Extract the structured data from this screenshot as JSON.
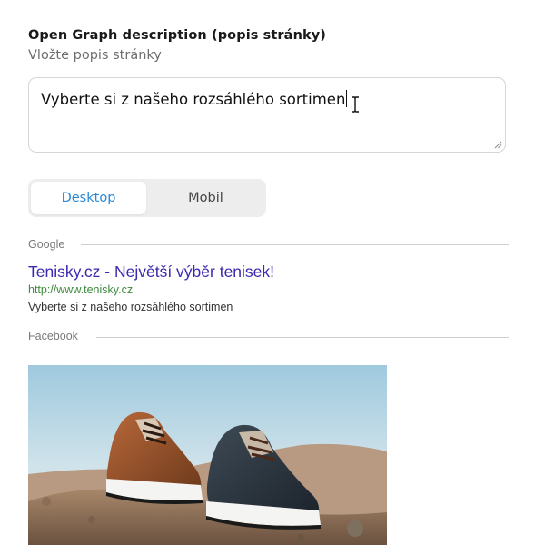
{
  "og_description": {
    "label": "Open Graph description (popis stránky)",
    "hint": "Vložte popis stránky",
    "value": "Vyberte si z našeho rozsáhlého sortimen"
  },
  "preview_toggle": {
    "options": [
      {
        "label": "Desktop",
        "active": true
      },
      {
        "label": "Mobil",
        "active": false
      }
    ],
    "accent_color": "#2a8ad9"
  },
  "google_preview": {
    "section_label": "Google",
    "title": "Tenisky.cz - Největší výběr tenisek!",
    "url": "http://www.tenisky.cz",
    "description": "Vyberte si z našeho rozsáhlého sortimen",
    "title_color": "#3b2ab0",
    "url_color": "#3d8a3d"
  },
  "facebook_preview": {
    "section_label": "Facebook",
    "image_icon": "sneakers-photo"
  }
}
